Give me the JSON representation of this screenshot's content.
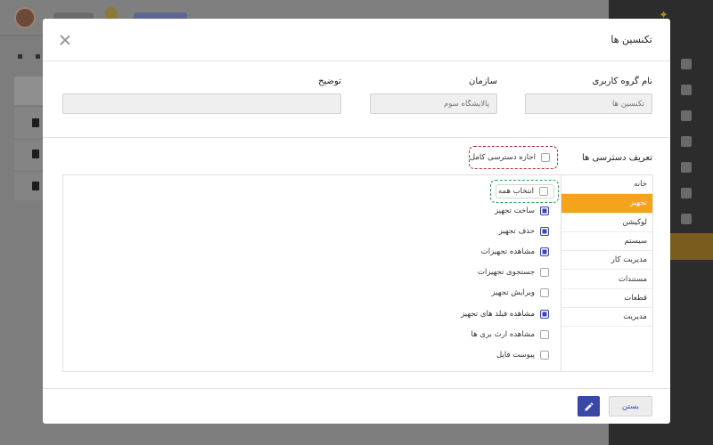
{
  "modal": {
    "title": "تکنسین ها",
    "fields": {
      "group_name": {
        "label": "نام گروه کاربری",
        "placeholder": "تکنسین ها"
      },
      "organization": {
        "label": "سازمان",
        "placeholder": "پالایشگاه سوم"
      },
      "description": {
        "label": "توضیح",
        "placeholder": ""
      }
    },
    "permissions": {
      "title": "تعریف دسترسی ها",
      "full_access_label": "اجازه دسترسی کامل",
      "full_access_checked": false,
      "select_all_label": "انتخاب همه",
      "select_all_checked": false,
      "categories": [
        "خانه",
        "تجهیز",
        "لوکیشن",
        "سیستم",
        "مدیریت کار",
        "مستندات",
        "قطعات",
        "مدیریت"
      ],
      "active_category": "تجهیز",
      "items": [
        {
          "label": "ساخت تجهیز",
          "checked": true
        },
        {
          "label": "حذف تجهیز",
          "checked": true
        },
        {
          "label": "مشاهده تجهیزات",
          "checked": true
        },
        {
          "label": "جستجوی تجهیزات",
          "checked": false
        },
        {
          "label": "ویرایش تجهیز",
          "checked": false
        },
        {
          "label": "مشاهده فیلد های تجهیز",
          "checked": true
        },
        {
          "label": "مشاهده ارث بری ها",
          "checked": false
        },
        {
          "label": "پیوست فایل",
          "checked": false
        }
      ]
    },
    "footer": {
      "close_label": "بستن"
    }
  },
  "colors": {
    "accent": "#3a46a8",
    "active_tab": "#f4a31a",
    "full_access_outline": "#b22a2a",
    "select_all_outline": "#2ea04a"
  },
  "icons": {
    "close": "close-icon",
    "edit": "pencil-icon"
  }
}
